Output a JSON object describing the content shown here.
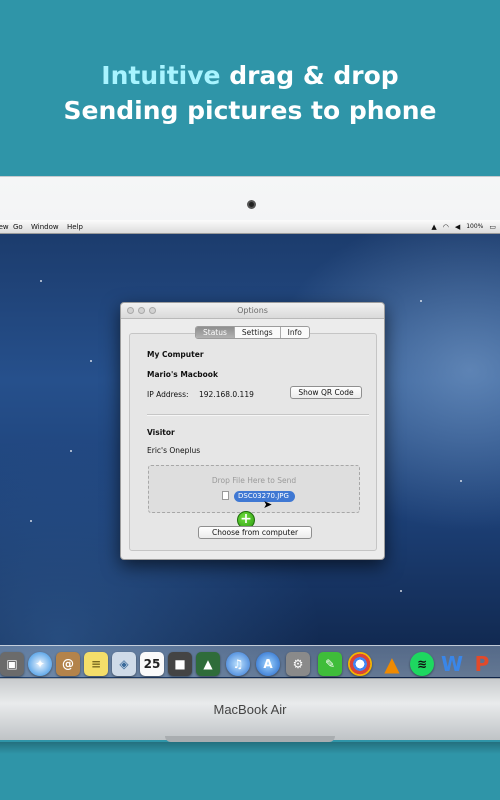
{
  "headline": {
    "line1_accent": "Intuitive",
    "line1_rest": "drag & drop",
    "line2": "Sending pictures to phone"
  },
  "menubar": {
    "items": [
      "View",
      "Go",
      "Window",
      "Help"
    ],
    "battery": "100%"
  },
  "window": {
    "title": "Options",
    "tabs": [
      "Status",
      "Settings",
      "Info"
    ],
    "active_tab": "Status",
    "my_computer_heading": "My Computer",
    "computer_name": "Mario's Macbook",
    "ip_label": "IP Address:",
    "ip_value": "192.168.0.119",
    "qr_button": "Show QR Code",
    "visitor_heading": "Visitor",
    "visitor_name": "Eric's Oneplus",
    "drop_text": "Drop File Here to Send",
    "dragged_file": "DSC03270.JPG",
    "choose_button": "Choose from computer"
  },
  "dock_icons": [
    "photo-booth-icon",
    "safari-icon",
    "contacts-icon",
    "notes-icon",
    "preview-icon",
    "calendar-icon",
    "facetime-icon",
    "iphoto-icon",
    "itunes-icon",
    "app-store-icon",
    "system-preferences-icon",
    "app-icon",
    "chrome-icon",
    "vlc-icon",
    "spotify-icon",
    "word-icon",
    "powerpoint-icon"
  ],
  "calendar_day": "25",
  "base": {
    "brand": "MacBook Air"
  },
  "colors": {
    "background": "#2f95a8",
    "accent_text": "#a8f4ff",
    "file_chip": "#3f78d3"
  }
}
